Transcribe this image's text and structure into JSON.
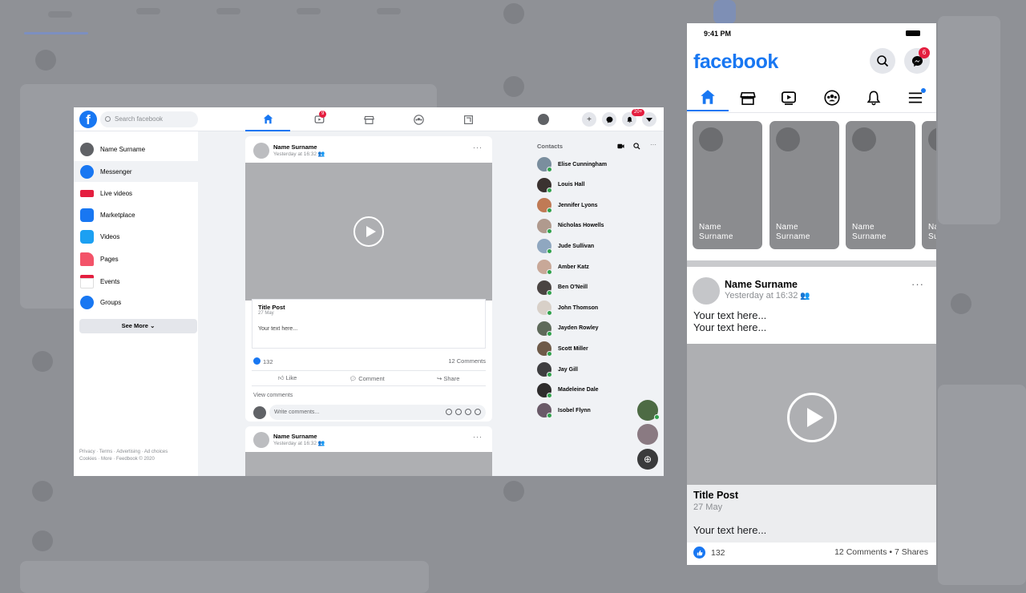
{
  "desktop": {
    "search_placeholder": "Search facebook",
    "logo_letter": "f",
    "nav_badges": {
      "watch": "9",
      "notifications": "20+"
    },
    "sidebar": {
      "items": [
        {
          "label": "Name Surname",
          "icon": "avatar",
          "color": "#606266"
        },
        {
          "label": "Messenger",
          "icon": "messenger-icon",
          "color": "#1877f2"
        },
        {
          "label": "Live videos",
          "icon": "live-icon",
          "color": "#e41e3f"
        },
        {
          "label": "Marketplace",
          "icon": "marketplace-icon",
          "color": "#1877f2"
        },
        {
          "label": "Videos",
          "icon": "videos-icon",
          "color": "#1877f2"
        },
        {
          "label": "Pages",
          "icon": "pages-icon",
          "color": "#f35369"
        },
        {
          "label": "Events",
          "icon": "events-icon",
          "color": "#e41e3f"
        },
        {
          "label": "Groups",
          "icon": "groups-icon",
          "color": "#1877f2"
        }
      ],
      "see_more": "See More",
      "footer_line1": "Privacy · Terms · Advertising · Ad choices",
      "footer_line2": "Cookies · More · Feedbook © 2020"
    },
    "post1": {
      "name": "Name Surname",
      "time": "Yesterday at 16:32",
      "title": "Title Post",
      "date": "27 May",
      "text": "Your text here...",
      "likes": "132",
      "comments": "12 Comments",
      "like_label": "Like",
      "comment_label": "Comment",
      "share_label": "Share",
      "view_comments": "View comments",
      "comment_placeholder": "Write comments..."
    },
    "post2": {
      "name": "Name Surname",
      "time": "Yesterday at 16:32"
    },
    "contacts": {
      "header": "Contacts",
      "list": [
        {
          "name": "Elise Cunningham",
          "color": "#7a8e9e"
        },
        {
          "name": "Louis Hall",
          "color": "#3a3230"
        },
        {
          "name": "Jennifer Lyons",
          "color": "#c07a55"
        },
        {
          "name": "Nicholas Howells",
          "color": "#b09a8e"
        },
        {
          "name": "Jude Sullivan",
          "color": "#8fa7c0"
        },
        {
          "name": "Amber Katz",
          "color": "#c8a898"
        },
        {
          "name": "Ben O'Neill",
          "color": "#4a4442"
        },
        {
          "name": "John Thomson",
          "color": "#d8d0c8"
        },
        {
          "name": "Jayden Rowley",
          "color": "#5e6a5a"
        },
        {
          "name": "Scott Miller",
          "color": "#6e5a48"
        },
        {
          "name": "Jay Gill",
          "color": "#3e3e40"
        },
        {
          "name": "Madeleine Dale",
          "color": "#2e2c2c"
        },
        {
          "name": "Isobel Flynn",
          "color": "#6a5a68"
        }
      ]
    }
  },
  "mobile": {
    "time": "9:41 PM",
    "logo": "facebook",
    "messenger_badge": "6",
    "stories": [
      {
        "first": "Name",
        "last": "Surname"
      },
      {
        "first": "Name",
        "last": "Surname"
      },
      {
        "first": "Name",
        "last": "Surname"
      },
      {
        "first": "Na",
        "last": "Su"
      }
    ],
    "post": {
      "name": "Name Surname",
      "time": "Yesterday at 16:32",
      "text_line1": "Your text here...",
      "text_line2": "Your text here...",
      "title": "Title Post",
      "date": "27 May",
      "body": "Your text here...",
      "likes": "132",
      "stats": "12 Comments • 7 Shares"
    }
  }
}
